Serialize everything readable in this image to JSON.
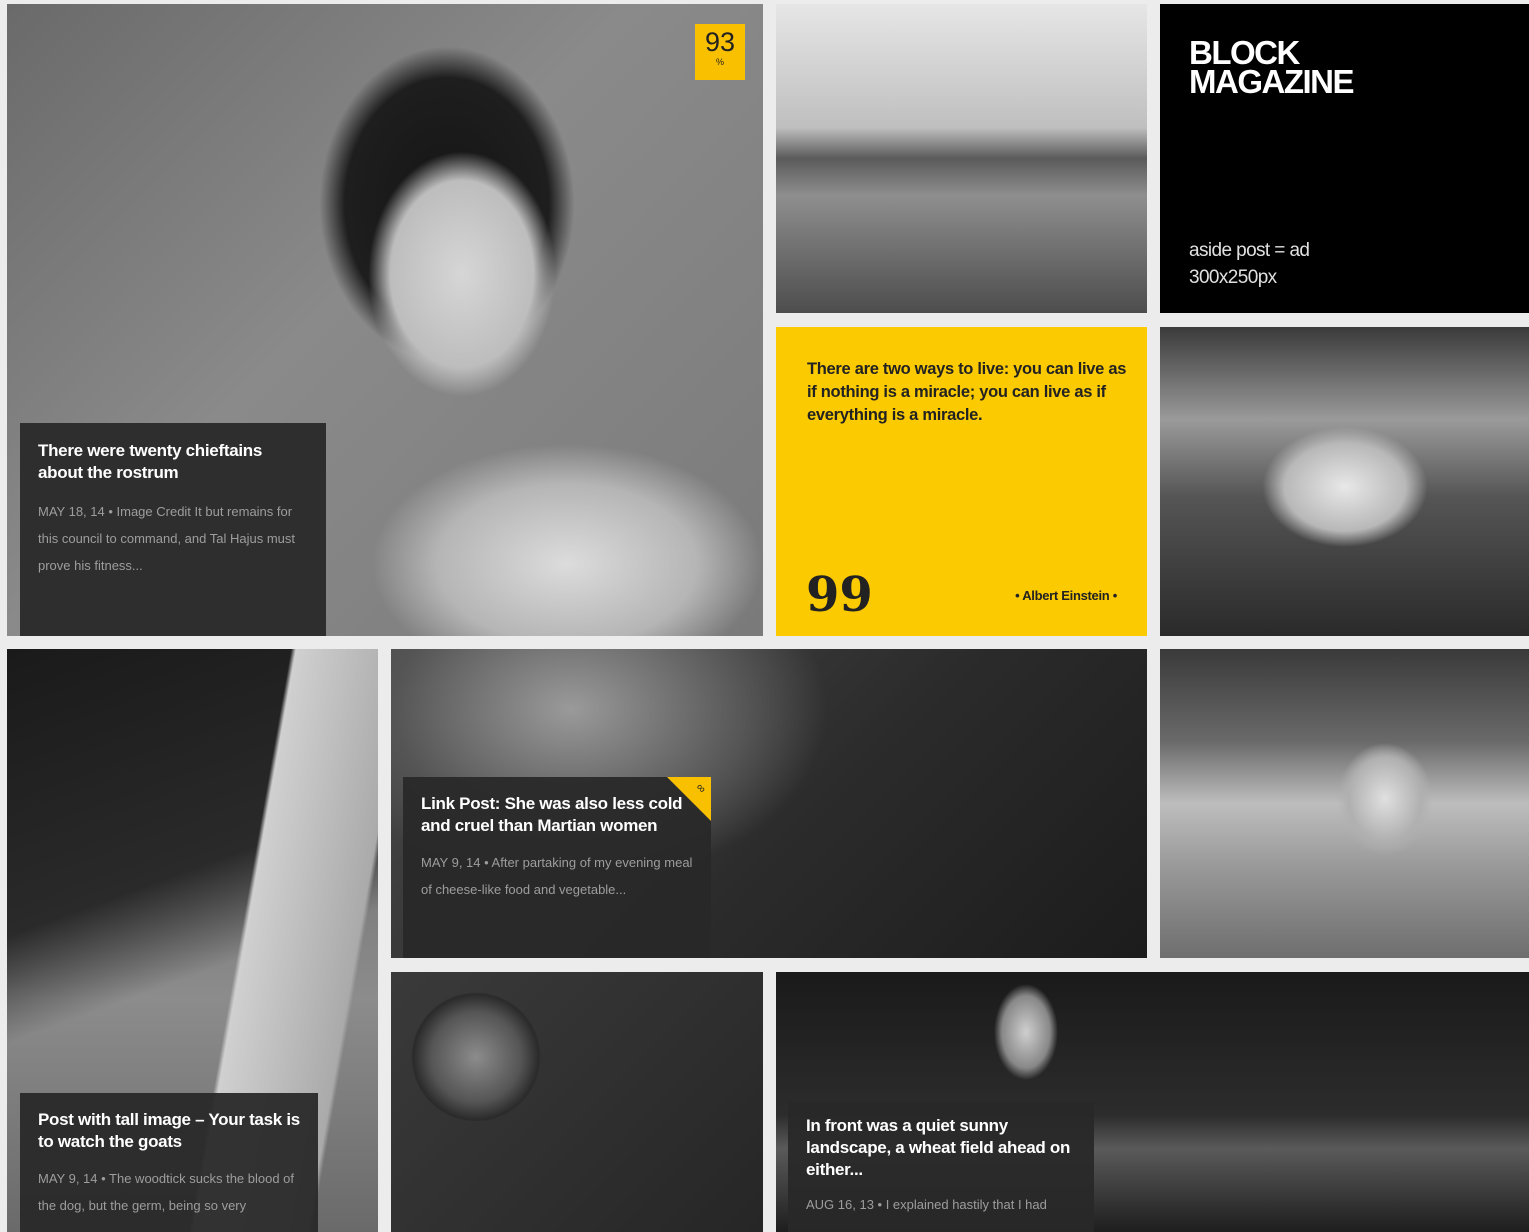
{
  "featured": {
    "score_value": "93",
    "score_unit": "%",
    "title": "There were twenty chieftains about the rostrum",
    "excerpt": "MAY 18, 14 • Image Credit It but remains for this council to command, and Tal Hajus must prove his fitness..."
  },
  "brand": {
    "name": "BLOCK MAGAZINE",
    "aside_note": "aside post = ad 300x250px"
  },
  "quote": {
    "text": "There are two ways to live: you can live as if nothing is a miracle; you can live as if everything is a miracle.",
    "mark": "99",
    "author": "• Albert Einstein •"
  },
  "link_post": {
    "title": "Link Post: She was also less cold and cruel than Martian women",
    "excerpt": "MAY 9, 14 • After partaking of my evening meal of cheese-like food and vegetable...",
    "icon": "link-icon"
  },
  "tall_post": {
    "title": "Post with tall image – Your task is to watch the goats",
    "excerpt": "MAY 9, 14 • The woodtick sucks the blood of the dog, but the germ, being so very"
  },
  "city_post": {
    "title": "In front was a quiet sunny landscape, a wheat field ahead on either...",
    "excerpt": "AUG 16, 13 • I explained hastily that I had"
  },
  "colors": {
    "accent": "#fbca01",
    "caption_bg": "#282828",
    "brand_bg": "#000000"
  }
}
